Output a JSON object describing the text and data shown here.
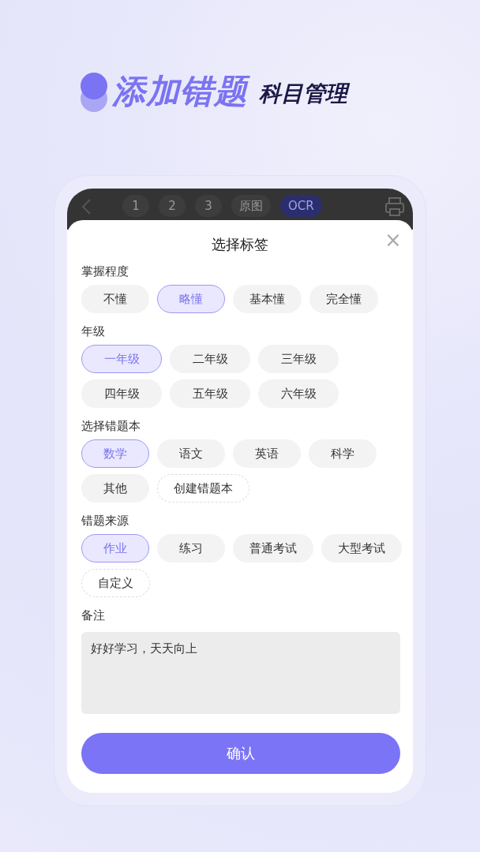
{
  "headline": {
    "title": "添加错题",
    "subtitle": "科目管理"
  },
  "toolbar": {
    "items": [
      {
        "label": "1",
        "selected": false
      },
      {
        "label": "2",
        "selected": false
      },
      {
        "label": "3",
        "selected": false
      },
      {
        "label": "原图",
        "selected": false
      },
      {
        "label": "OCR",
        "selected": true
      }
    ]
  },
  "sheet": {
    "title": "选择标签",
    "close": "×",
    "groups": [
      {
        "label": "掌握程度",
        "chips": [
          {
            "label": "不懂",
            "kind": "chip",
            "selected": false
          },
          {
            "label": "略懂",
            "kind": "chip",
            "selected": true
          },
          {
            "label": "基本懂",
            "kind": "chip",
            "selected": false
          },
          {
            "label": "完全懂",
            "kind": "chip",
            "selected": false
          }
        ]
      },
      {
        "label": "年级",
        "chips": [
          {
            "label": "一年级",
            "kind": "chip",
            "selected": true
          },
          {
            "label": "二年级",
            "kind": "chip",
            "selected": false
          },
          {
            "label": "三年级",
            "kind": "chip",
            "selected": false
          },
          {
            "label": "四年级",
            "kind": "chip",
            "selected": false
          },
          {
            "label": "五年级",
            "kind": "chip",
            "selected": false
          },
          {
            "label": "六年级",
            "kind": "chip",
            "selected": false
          }
        ]
      },
      {
        "label": "选择错题本",
        "chips": [
          {
            "label": "数学",
            "kind": "chip",
            "selected": true
          },
          {
            "label": "语文",
            "kind": "chip",
            "selected": false
          },
          {
            "label": "英语",
            "kind": "chip",
            "selected": false
          },
          {
            "label": "科学",
            "kind": "chip",
            "selected": false
          },
          {
            "label": "其他",
            "kind": "chip",
            "selected": false
          },
          {
            "label": "创建错题本",
            "kind": "add",
            "selected": false
          }
        ]
      },
      {
        "label": "错题来源",
        "chips": [
          {
            "label": "作业",
            "kind": "chip",
            "selected": true
          },
          {
            "label": "练习",
            "kind": "chip",
            "selected": false
          },
          {
            "label": "普通考试",
            "kind": "chip",
            "selected": false
          },
          {
            "label": "大型考试",
            "kind": "chip",
            "selected": false
          },
          {
            "label": "自定义",
            "kind": "add",
            "selected": false
          }
        ]
      }
    ],
    "note": {
      "label": "备注",
      "value": "好好学习，天天向上"
    },
    "confirm": "确认"
  }
}
